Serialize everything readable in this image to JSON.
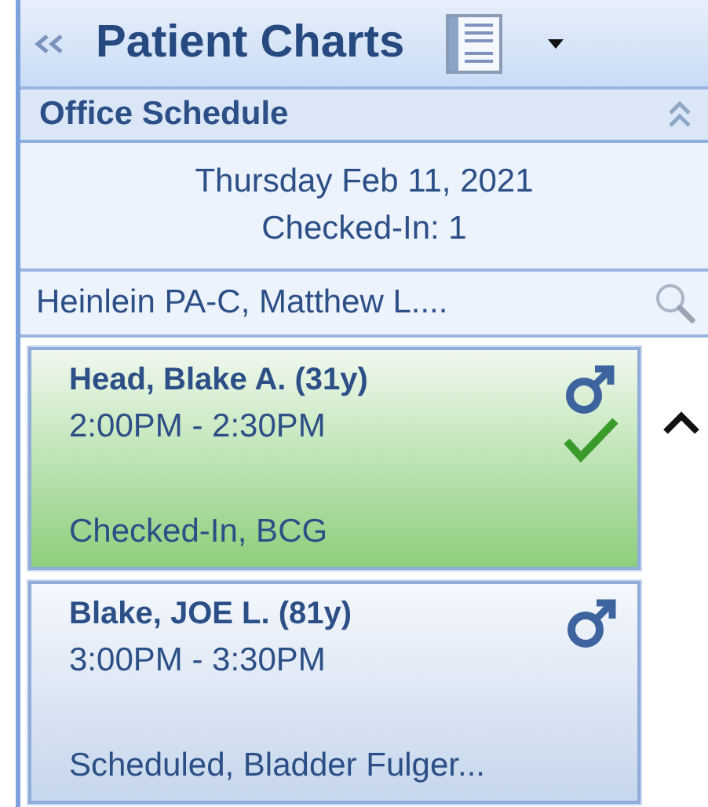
{
  "header": {
    "title": "Patient Charts"
  },
  "section": {
    "title": "Office Schedule"
  },
  "schedule": {
    "date": "Thursday Feb 11, 2021",
    "checked_in_count": "Checked-In: 1"
  },
  "provider": {
    "name": "Heinlein PA-C, Matthew L...."
  },
  "appointments": [
    {
      "patient": "Head, Blake A. (31y)",
      "time": "2:00PM - 2:30PM",
      "status": "Checked-In, BCG",
      "checked_in": true,
      "selected": true
    },
    {
      "patient": "Blake, JOE L. (81y)",
      "time": "3:00PM - 3:30PM",
      "status": "Scheduled, Bladder Fulger...",
      "checked_in": false,
      "selected": false
    }
  ]
}
